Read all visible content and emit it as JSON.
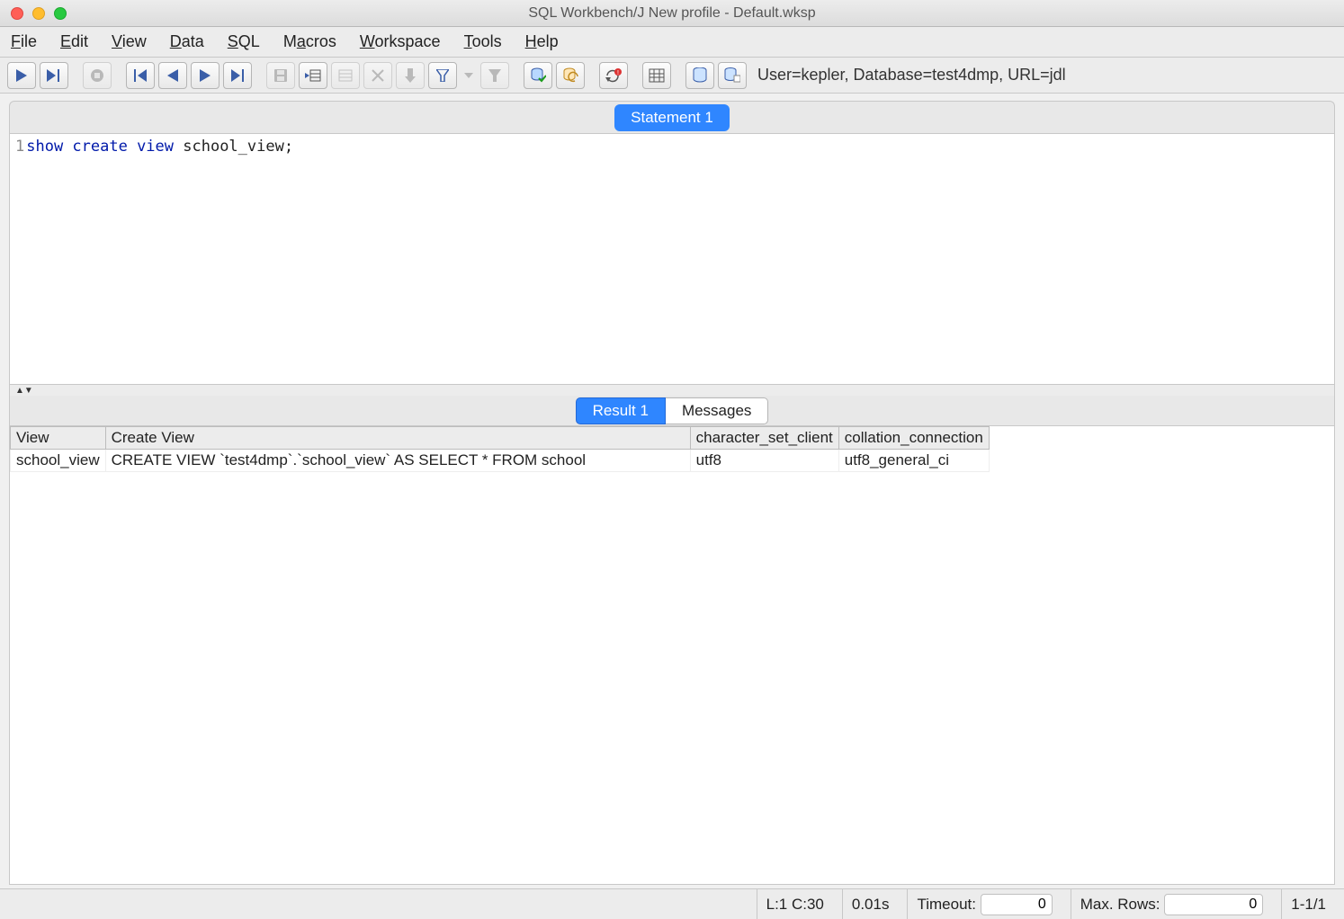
{
  "window": {
    "title": "SQL Workbench/J New profile - Default.wksp"
  },
  "menubar": {
    "items": [
      {
        "accel": "F",
        "rest": "ile"
      },
      {
        "accel": "E",
        "rest": "dit"
      },
      {
        "accel": "V",
        "rest": "iew"
      },
      {
        "accel": "D",
        "rest": "ata"
      },
      {
        "accel": "S",
        "rest": "QL"
      },
      {
        "pre": "M",
        "accel": "a",
        "rest": "cros"
      },
      {
        "accel": "W",
        "rest": "orkspace"
      },
      {
        "accel": "T",
        "rest": "ools"
      },
      {
        "accel": "H",
        "rest": "elp"
      }
    ]
  },
  "connection_info": "User=kepler, Database=test4dmp, URL=jdl",
  "editor": {
    "tab_label": "Statement 1",
    "line_number": "1",
    "kw": "show create view",
    "rest": " school_view;"
  },
  "results": {
    "tabs": {
      "active": "Result 1",
      "other": "Messages"
    },
    "columns": [
      "View",
      "Create View",
      "character_set_client",
      "collation_connection"
    ],
    "rows": [
      [
        "school_view",
        "CREATE VIEW `test4dmp`.`school_view` AS SELECT * FROM   school",
        "utf8",
        "utf8_general_ci"
      ]
    ]
  },
  "status": {
    "cursor": "L:1 C:30",
    "exec_time": "0.01s",
    "timeout_label": "Timeout:",
    "timeout_value": "0",
    "maxrows_label": "Max. Rows:",
    "maxrows_value": "0",
    "row_range": "1-1/1"
  }
}
